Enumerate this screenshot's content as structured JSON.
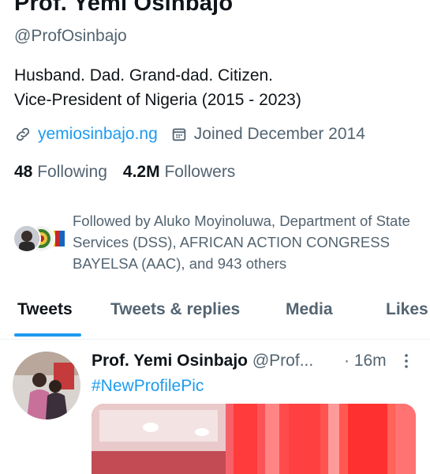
{
  "profile": {
    "name": "Prof. Yemi Osinbajo",
    "handle": "@ProfOsinbajo",
    "bio_line1": "Husband. Dad. Grand-dad. Citizen.",
    "bio_line2": "Vice-President of Nigeria (2015 - 2023)",
    "website": "yemiosinbajo.ng",
    "joined": "Joined December 2014",
    "following_count": "48",
    "following_label": "Following",
    "followers_count": "4.2M",
    "followers_label": "Followers",
    "followed_by": "Followed by Aluko Moyinoluwa, Department of State Services (DSS), AFRICAN ACTION CONGRESS BAYELSA (AAC), and 943 others"
  },
  "tabs": [
    {
      "label": "Tweets",
      "active": true
    },
    {
      "label": "Tweets & replies",
      "active": false
    },
    {
      "label": "Media",
      "active": false
    },
    {
      "label": "Likes",
      "active": false
    }
  ],
  "tweet": {
    "name": "Prof. Yemi Osinbajo",
    "handle": "@Prof...",
    "time": "· 16m",
    "hashtag": "#NewProfilePic"
  },
  "colors": {
    "accent": "#1d9bf0",
    "text_primary": "#0f1419",
    "text_secondary": "#536471"
  },
  "icons": {
    "link": "link-icon",
    "calendar": "calendar-icon",
    "more": "more-vertical-icon"
  }
}
